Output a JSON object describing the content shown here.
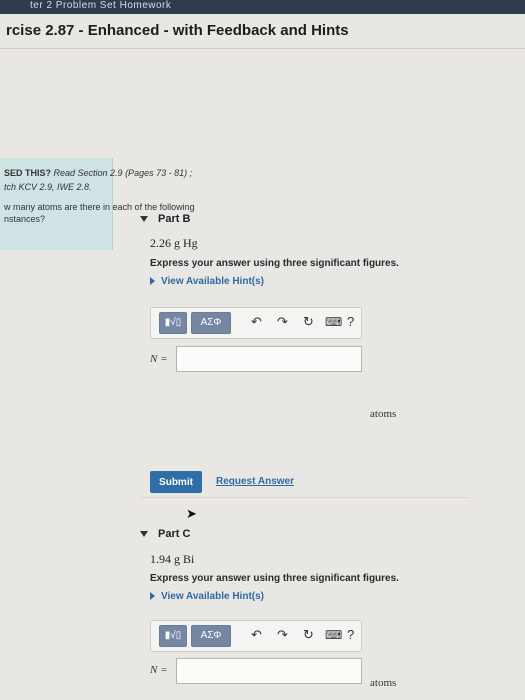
{
  "header": {
    "strip_text": "ter 2 Problem Set Homework",
    "title": "rcise 2.87 - Enhanced - with Feedback and Hints"
  },
  "left_panel": {
    "line1_bold": "SED THIS?",
    "line1_rest": " Read Section 2.9 (Pages 73 - 81) ;",
    "line2": "tch KCV 2.9, IWE 2.8.",
    "line3": "w many atoms are there in each of the following",
    "line4": "nstances?"
  },
  "part_b": {
    "label": "Part B",
    "formula": "2.26 g Hg",
    "instruction": "Express your answer using three significant figures.",
    "hint_link": "View Available Hint(s)",
    "toolbar": {
      "templates": "▮√▯",
      "symbols": "ΑΣΦ"
    },
    "answer_label": "N =",
    "answer_value": "",
    "unit": "atoms",
    "submit": "Submit",
    "request_answer": "Request Answer"
  },
  "part_c": {
    "label": "Part C",
    "formula": "1.94 g Bi",
    "instruction": "Express your answer using three significant figures.",
    "hint_link": "View Available Hint(s)",
    "toolbar": {
      "templates": "▮√▯",
      "symbols": "ΑΣΦ"
    },
    "answer_label": "N =",
    "answer_value": "",
    "unit": "atoms"
  },
  "icons": [
    "undo-icon",
    "redo-icon",
    "reset-icon",
    "keyboard-icon",
    "help-icon",
    "collapse-triangle-icon",
    "expand-triangle-icon"
  ],
  "colors": {
    "accent": "#2e6fa8",
    "hint_blue": "#2c6aa5",
    "panel_teal": "#cfe3e4"
  }
}
